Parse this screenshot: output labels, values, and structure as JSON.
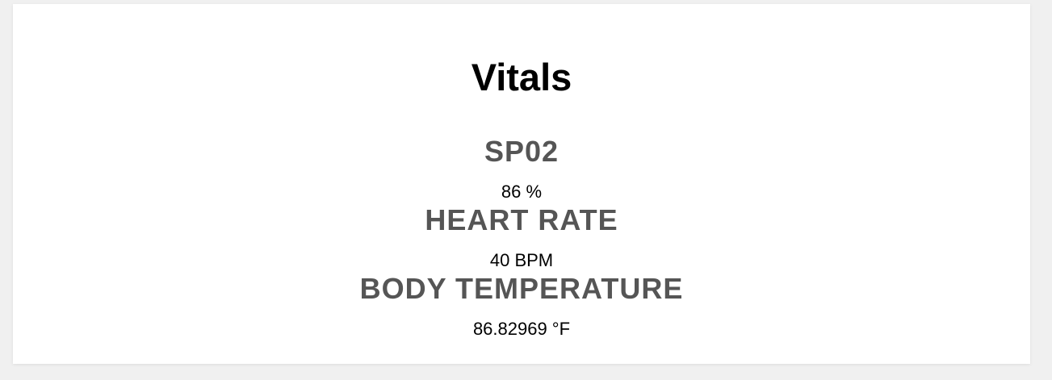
{
  "page": {
    "title": "Vitals"
  },
  "vitals": [
    {
      "label": "SP02",
      "value": "86 %"
    },
    {
      "label": "HEART RATE",
      "value": "40 BPM"
    },
    {
      "label": "BODY TEMPERATURE",
      "value": "86.82969 °F"
    }
  ]
}
